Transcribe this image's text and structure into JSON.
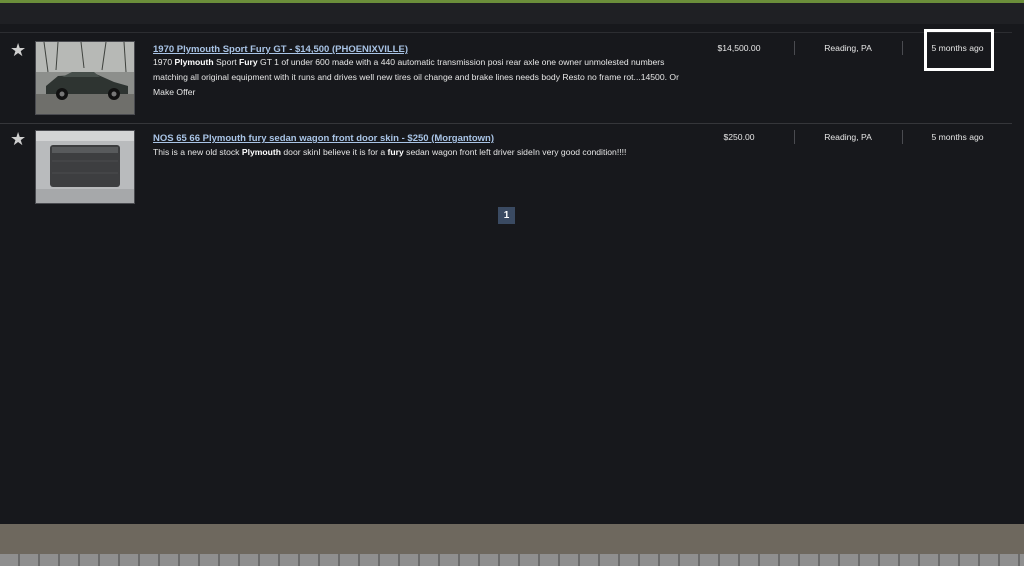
{
  "listings": [
    {
      "title": "1970 Plymouth Sport Fury GT - $14,500 (PHOENIXVILLE)",
      "desc_parts": [
        "1970 ",
        "Plymouth",
        " Sport ",
        "Fury",
        " GT 1 of under 600 made with a 440 automatic transmission posi rear axle one owner unmolested numbers matching all original equipment with it runs and drives well new tires oil change and brake lines needs body Resto no frame rot...14500. Or Make Offer"
      ],
      "price": "$14,500.00",
      "location": "Reading, PA",
      "age": "5 months ago"
    },
    {
      "title": "NOS 65 66 Plymouth fury sedan wagon front door skin - $250 (Morgantown)",
      "desc_parts": [
        "This is a new old stock ",
        "Plymouth",
        " door skinI believe it is for a ",
        "fury",
        " sedan wagon front left driver sideIn very good condition!!!!"
      ],
      "price": "$250.00",
      "location": "Reading, PA",
      "age": "5 months ago"
    }
  ],
  "pagination": {
    "current_page": "1"
  },
  "icons": {
    "favorite": "star-icon"
  },
  "colors": {
    "accent": "#6b8e3a",
    "link": "#a9c4e6",
    "background": "#17181c"
  }
}
